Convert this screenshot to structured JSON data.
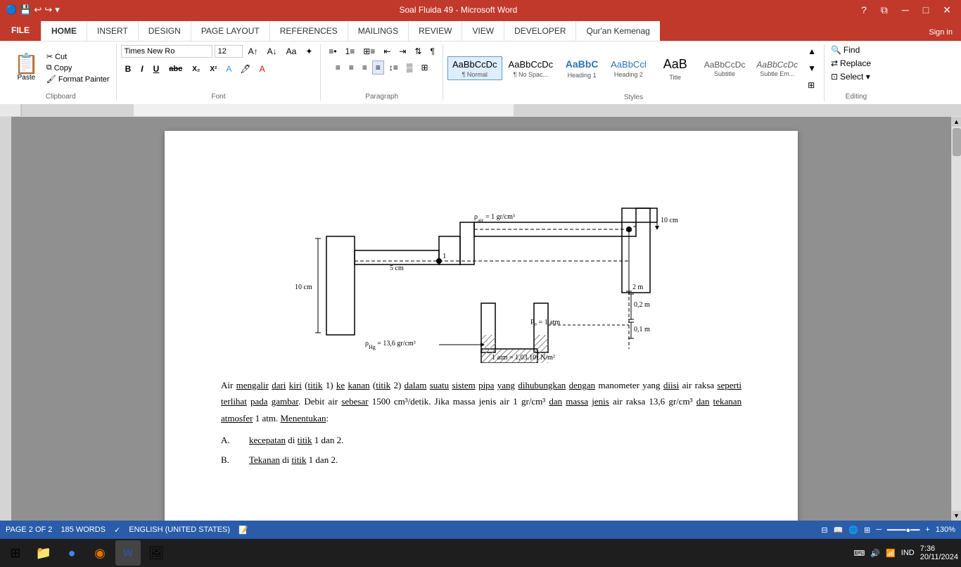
{
  "titlebar": {
    "title": "Soal Fluida 49 - Microsoft Word",
    "help_icon": "?",
    "resize_icon": "⧉",
    "minimize_icon": "─",
    "maximize_icon": "□",
    "close_icon": "✕"
  },
  "tabs": {
    "file": "FILE",
    "items": [
      "HOME",
      "INSERT",
      "DESIGN",
      "PAGE LAYOUT",
      "REFERENCES",
      "MAILINGS",
      "REVIEW",
      "VIEW",
      "DEVELOPER",
      "Qur'an Kemenag"
    ],
    "active": "HOME",
    "signin": "Sign in"
  },
  "clipboard": {
    "label": "Clipboard",
    "paste_label": "Paste",
    "cut_label": "Cut",
    "copy_label": "Copy",
    "format_painter_label": "Format Painter"
  },
  "font": {
    "label": "Font",
    "font_name": "Times New Ro",
    "font_size": "12",
    "bold": "B",
    "italic": "I",
    "underline": "U",
    "strikethrough": "abc",
    "subscript": "X₂",
    "superscript": "X²"
  },
  "paragraph": {
    "label": "Paragraph"
  },
  "styles": {
    "label": "Styles",
    "items": [
      {
        "id": "normal",
        "preview": "AaBbCcDc",
        "label": "¶ Normal",
        "active": true
      },
      {
        "id": "no-space",
        "preview": "AaBbCcDc",
        "label": "¶ No Spac..."
      },
      {
        "id": "heading1",
        "preview": "AaBbC",
        "label": "Heading 1"
      },
      {
        "id": "heading2",
        "preview": "AaBbCcl",
        "label": "Heading 2"
      },
      {
        "id": "title",
        "preview": "AaB",
        "label": "Title"
      },
      {
        "id": "subtitle",
        "preview": "AaBbCcDc",
        "label": "Subtitle"
      },
      {
        "id": "subtle-em",
        "preview": "AaBbCcDc",
        "label": "Subtle Em..."
      }
    ]
  },
  "editing": {
    "label": "Editing",
    "find_label": "Find",
    "replace_label": "Replace",
    "select_label": "Select ▾"
  },
  "status": {
    "page": "PAGE 2 OF 2",
    "words": "185 WORDS",
    "language": "ENGLISH (UNITED STATES)",
    "zoom": "130%"
  },
  "document": {
    "paragraph1": "Air mengalir dari kiri (titik 1) ke kanan (titik 2) dalam suatu sistem pipa yang dihubungkan dengan manometer yang diisi air raksa seperti terlihat pada gambar. Debit air sebesar 1500 cm³/detik. Jika massa jenis air 1 gr/cm³ dan massa jenis air raksa 13,6 gr/cm³ dan tekanan atmosfer 1 atm. Menentukan:",
    "list_a": "A.",
    "list_a_text": "kecepatan di titik 1 dan 2.",
    "list_b": "B.",
    "list_b_text": "Tekanan di titik 1 dan 2."
  },
  "taskbar": {
    "start_icon": "⊞",
    "items": [
      "🗂",
      "🌐",
      "🔵",
      "🌀",
      "🖼"
    ],
    "time": "7:36",
    "date": "20/11/2024",
    "lang": "IND"
  }
}
